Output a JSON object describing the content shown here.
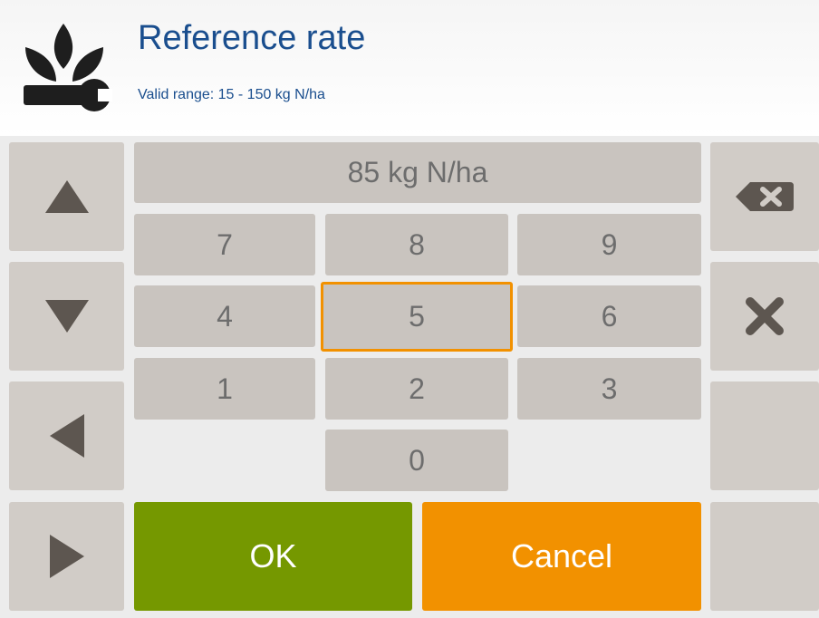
{
  "header": {
    "title": "Reference rate",
    "subtitle": "Valid range: 15 - 150 kg N/ha",
    "icon": "plant-wrench-icon"
  },
  "display": {
    "value": "85 kg N/ha"
  },
  "keypad": {
    "keys": [
      "7",
      "8",
      "9",
      "4",
      "5",
      "6",
      "1",
      "2",
      "3",
      "0"
    ],
    "focused_key": "5"
  },
  "actions": {
    "ok_label": "OK",
    "cancel_label": "Cancel"
  },
  "nav": {
    "icons": [
      "arrow-up-icon",
      "arrow-down-icon",
      "arrow-left-icon",
      "arrow-right-icon"
    ]
  },
  "right_panel": {
    "icons": [
      "backspace-icon",
      "clear-icon"
    ]
  },
  "colors": {
    "ok": "#759800",
    "cancel": "#f29100",
    "focus_border": "#f29100",
    "key_bg": "#c9c4bf",
    "title": "#1a4e8e"
  }
}
